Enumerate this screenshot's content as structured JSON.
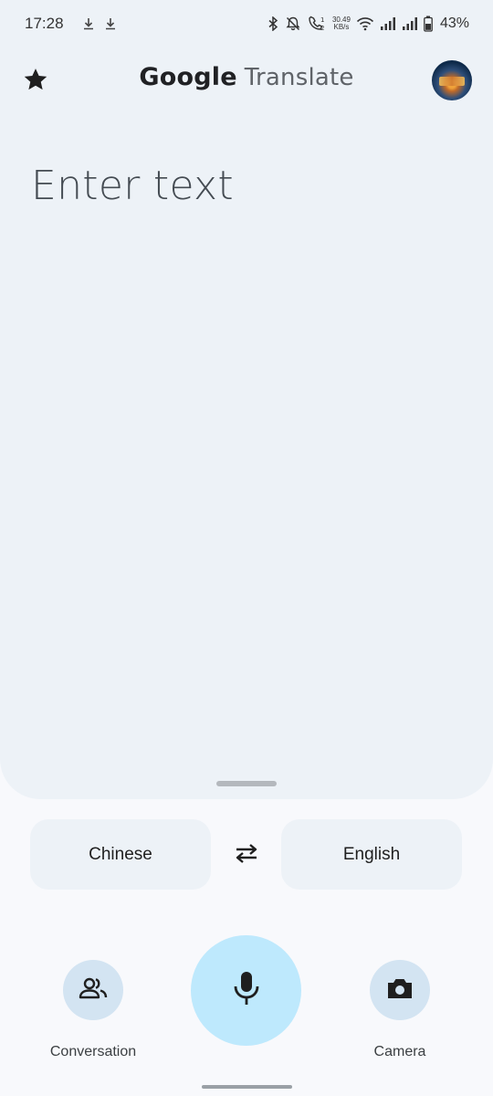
{
  "status_bar": {
    "time": "17:28",
    "net_speed_value": "30.49",
    "net_speed_unit": "KB/s",
    "battery": "43%",
    "icons": [
      "download-icon",
      "download-icon",
      "bluetooth-icon",
      "mute-icon",
      "call-icon",
      "wifi-icon",
      "signal-icon",
      "signal-icon",
      "battery-icon"
    ]
  },
  "app_bar": {
    "title_brand": "Google",
    "title_product": "Translate",
    "favorites_icon": "star-icon",
    "avatar_icon": "profile-avatar"
  },
  "input": {
    "placeholder": "Enter text"
  },
  "languages": {
    "source": "Chinese",
    "target": "English",
    "swap_icon": "swap-arrows-icon"
  },
  "actions": {
    "conversation_label": "Conversation",
    "camera_label": "Camera",
    "mic_icon": "microphone-icon"
  },
  "colors": {
    "panel_bg": "#edf2f7",
    "page_bg": "#f8f9fc",
    "mic_bg": "#bee9fd",
    "action_bg": "#d3e4f2"
  }
}
